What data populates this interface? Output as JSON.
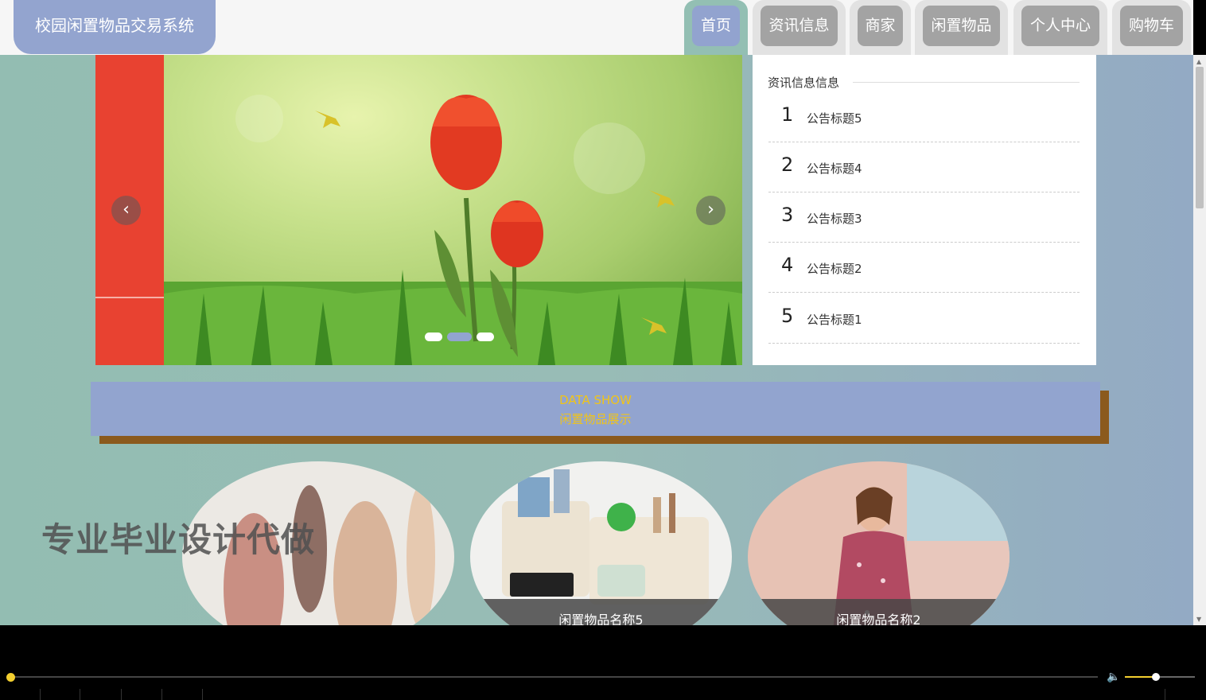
{
  "header": {
    "logo": "校园闲置物品交易系统",
    "nav": [
      {
        "label": "首页",
        "active": true
      },
      {
        "label": "资讯信息",
        "active": false
      },
      {
        "label": "商家",
        "active": false
      },
      {
        "label": "闲置物品",
        "active": false
      },
      {
        "label": "个人中心",
        "active": false
      },
      {
        "label": "购物车",
        "active": false
      }
    ]
  },
  "banner": {
    "prev_icon": "chevron-left-icon",
    "next_icon": "chevron-right-icon",
    "prev_glyph": "‹",
    "next_glyph": "›",
    "slide_count": 3,
    "active_slide": 2
  },
  "news": {
    "title": "资讯信息信息",
    "items": [
      {
        "num": "1",
        "text": "公告标题5"
      },
      {
        "num": "2",
        "text": "公告标题4"
      },
      {
        "num": "3",
        "text": "公告标题3"
      },
      {
        "num": "4",
        "text": "公告标题2"
      },
      {
        "num": "5",
        "text": "公告标题1"
      }
    ]
  },
  "section": {
    "en": "DATA SHOW",
    "cn": "闲置物品展示"
  },
  "products": [
    {
      "name": ""
    },
    {
      "name": "闲置物品名称5"
    },
    {
      "name": "闲置物品名称2"
    }
  ],
  "watermark": "专业毕业设计代做",
  "colors": {
    "accent": "#92a4cf",
    "accent_green": "#93bfb3",
    "section_text": "#f0c419",
    "section_shadow": "#8b5a1d",
    "banner_red": "#e84231"
  },
  "player": {
    "progress": 0.0,
    "volume": 0.45,
    "volume_icon": "volume-icon"
  }
}
